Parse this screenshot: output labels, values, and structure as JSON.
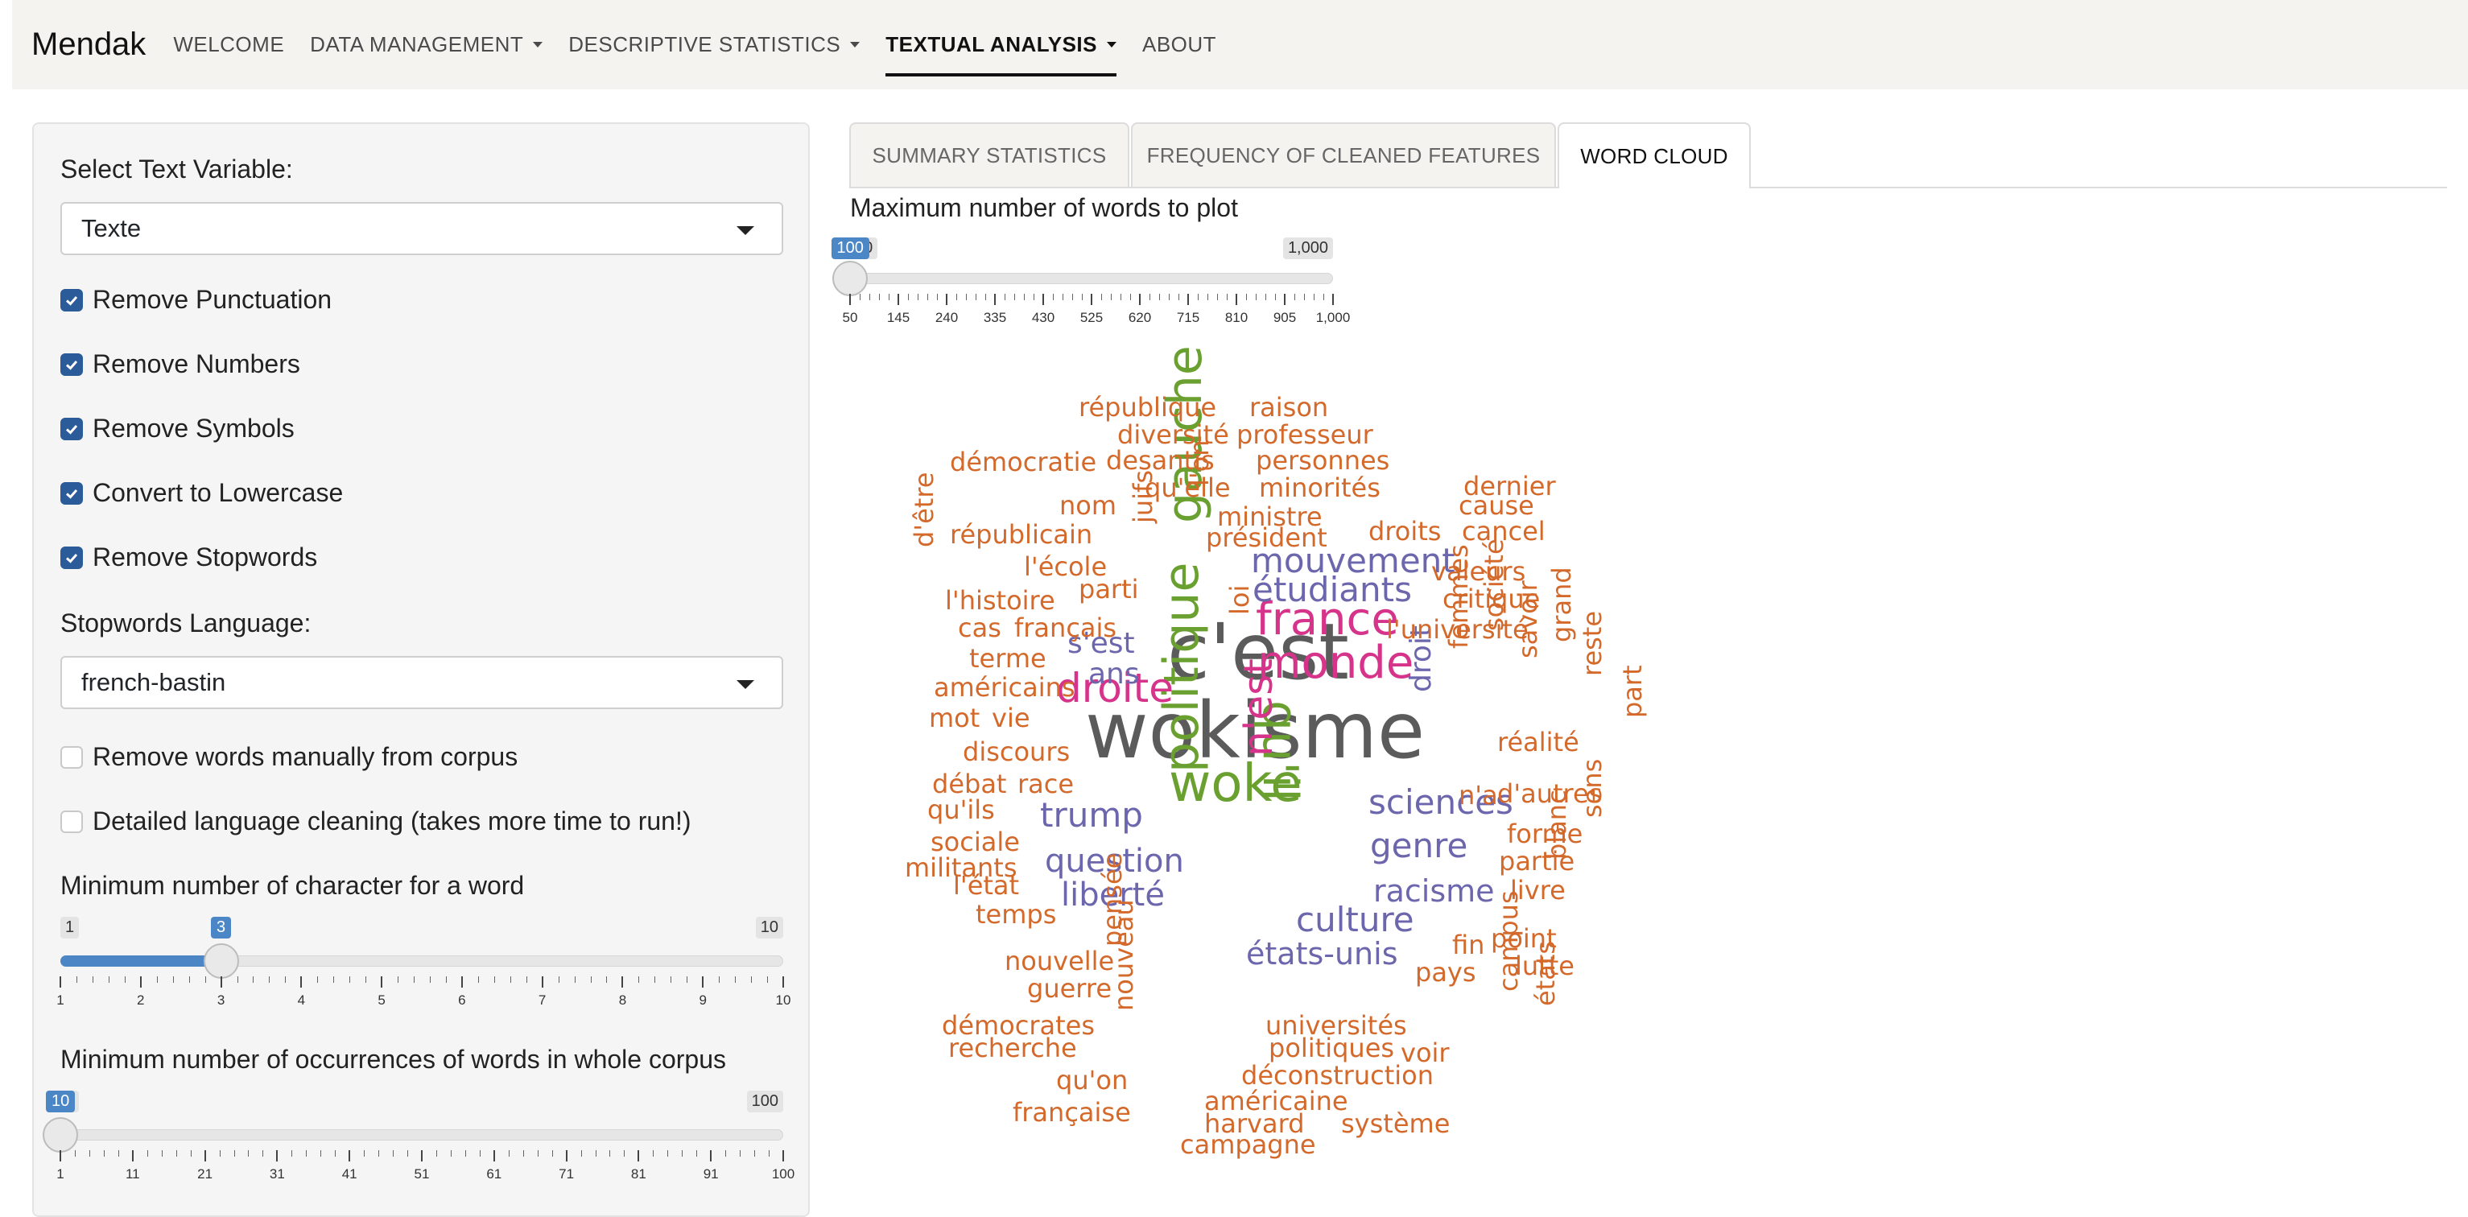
{
  "nav": {
    "brand": "Mendak",
    "items": [
      {
        "label": "WELCOME",
        "dropdown": false,
        "active": false
      },
      {
        "label": "DATA MANAGEMENT",
        "dropdown": true,
        "active": false
      },
      {
        "label": "DESCRIPTIVE STATISTICS",
        "dropdown": true,
        "active": false
      },
      {
        "label": "TEXTUAL ANALYSIS",
        "dropdown": true,
        "active": true
      },
      {
        "label": "ABOUT",
        "dropdown": false,
        "active": false
      }
    ]
  },
  "sidebar": {
    "text_variable_label": "Select Text Variable:",
    "text_variable_value": "Texte",
    "checkboxes": [
      {
        "label": "Remove Punctuation",
        "checked": true
      },
      {
        "label": "Remove Numbers",
        "checked": true
      },
      {
        "label": "Remove Symbols",
        "checked": true
      },
      {
        "label": "Convert to Lowercase",
        "checked": true
      },
      {
        "label": "Remove Stopwords",
        "checked": true
      }
    ],
    "stopwords_label": "Stopwords Language:",
    "stopwords_value": "french-bastin",
    "options": [
      {
        "label": "Remove words manually from corpus",
        "checked": false
      },
      {
        "label": "Detailed language cleaning (takes more time to run!)",
        "checked": false
      }
    ],
    "min_char": {
      "label": "Minimum number of character for a word",
      "min": "1",
      "max": "10",
      "value": "3",
      "ticks": [
        "1",
        "2",
        "3",
        "4",
        "5",
        "6",
        "7",
        "8",
        "9",
        "10"
      ]
    },
    "min_occ": {
      "label": "Minimum number of occurrences of words in whole corpus",
      "min": "1",
      "max": "100",
      "value": "10",
      "ticks": [
        "1",
        "11",
        "21",
        "31",
        "41",
        "51",
        "61",
        "71",
        "81",
        "91",
        "100"
      ]
    }
  },
  "tabs": [
    {
      "label": "SUMMARY STATISTICS",
      "active": false
    },
    {
      "label": "FREQUENCY OF CLEANED FEATURES",
      "active": false
    },
    {
      "label": "WORD CLOUD",
      "active": true
    }
  ],
  "wordcloud": {
    "max_words_label": "Maximum number of words to plot",
    "slider": {
      "min": "50",
      "max": "1,000",
      "value": "100",
      "ticks": [
        "50",
        "145",
        "240",
        "335",
        "430",
        "525",
        "620",
        "715",
        "810",
        "905",
        "1,000"
      ]
    },
    "colors": {
      "gray": "#5b5b5b",
      "green": "#6aa02f",
      "pink": "#d6338a",
      "purple": "#6c66ad",
      "orange": "#d3692a"
    },
    "words": [
      {
        "text": "wokisme",
        "color": "gray",
        "tier": 1
      },
      {
        "text": "c'est",
        "color": "gray",
        "tier": 1
      },
      {
        "text": "woke",
        "color": "green",
        "tier": 2
      },
      {
        "text": "gauche",
        "color": "green",
        "tier": 2
      },
      {
        "text": "politique",
        "color": "green",
        "tier": 2
      },
      {
        "text": "qu'il",
        "color": "green",
        "tier": 2
      },
      {
        "text": "france",
        "color": "pink",
        "tier": 3
      },
      {
        "text": "monde",
        "color": "pink",
        "tier": 3
      },
      {
        "text": "droite",
        "color": "pink",
        "tier": 3
      },
      {
        "text": "n'est",
        "color": "pink",
        "tier": 3
      },
      {
        "text": "mouvement",
        "color": "purple",
        "tier": 4
      },
      {
        "text": "étudiants",
        "color": "purple",
        "tier": 4
      },
      {
        "text": "sciences",
        "color": "purple",
        "tier": 4
      },
      {
        "text": "genre",
        "color": "purple",
        "tier": 4
      },
      {
        "text": "trump",
        "color": "purple",
        "tier": 4
      },
      {
        "text": "culture",
        "color": "purple",
        "tier": 4
      },
      {
        "text": "question",
        "color": "purple",
        "tier": 4
      },
      {
        "text": "liberté",
        "color": "purple",
        "tier": 4
      },
      {
        "text": "racisme",
        "color": "purple",
        "tier": 4
      },
      {
        "text": "s'est",
        "color": "purple",
        "tier": 4
      },
      {
        "text": "ans",
        "color": "purple",
        "tier": 4
      },
      {
        "text": "droit",
        "color": "purple",
        "tier": 4
      },
      {
        "text": "états-unis",
        "color": "purple",
        "tier": 4
      },
      {
        "text": "république",
        "color": "orange",
        "tier": 5
      },
      {
        "text": "raison",
        "color": "orange",
        "tier": 5
      },
      {
        "text": "diversité",
        "color": "orange",
        "tier": 5
      },
      {
        "text": "professeur",
        "color": "orange",
        "tier": 5
      },
      {
        "text": "démocratie",
        "color": "orange",
        "tier": 5
      },
      {
        "text": "desantis",
        "color": "orange",
        "tier": 5
      },
      {
        "text": "personnes",
        "color": "orange",
        "tier": 5
      },
      {
        "text": "qu'elle",
        "color": "orange",
        "tier": 5
      },
      {
        "text": "minorités",
        "color": "orange",
        "tier": 5
      },
      {
        "text": "dernier",
        "color": "orange",
        "tier": 5
      },
      {
        "text": "nom",
        "color": "orange",
        "tier": 5
      },
      {
        "text": "ministre",
        "color": "orange",
        "tier": 5
      },
      {
        "text": "cause",
        "color": "orange",
        "tier": 5
      },
      {
        "text": "républicain",
        "color": "orange",
        "tier": 5
      },
      {
        "text": "président",
        "color": "orange",
        "tier": 5
      },
      {
        "text": "droits",
        "color": "orange",
        "tier": 5
      },
      {
        "text": "cancel",
        "color": "orange",
        "tier": 5
      },
      {
        "text": "l'école",
        "color": "orange",
        "tier": 5
      },
      {
        "text": "juifs",
        "color": "orange",
        "tier": 5
      },
      {
        "text": "l'on",
        "color": "orange",
        "tier": 5
      },
      {
        "text": "valeurs",
        "color": "orange",
        "tier": 5
      },
      {
        "text": "parti",
        "color": "orange",
        "tier": 5
      },
      {
        "text": "critique",
        "color": "orange",
        "tier": 5
      },
      {
        "text": "l'histoire",
        "color": "orange",
        "tier": 5
      },
      {
        "text": "d'être",
        "color": "orange",
        "tier": 5
      },
      {
        "text": "cas",
        "color": "orange",
        "tier": 5
      },
      {
        "text": "français",
        "color": "orange",
        "tier": 5
      },
      {
        "text": "loi",
        "color": "orange",
        "tier": 5
      },
      {
        "text": "l'université",
        "color": "orange",
        "tier": 5
      },
      {
        "text": "terme",
        "color": "orange",
        "tier": 5
      },
      {
        "text": "société",
        "color": "orange",
        "tier": 5
      },
      {
        "text": "femmes",
        "color": "orange",
        "tier": 5
      },
      {
        "text": "savoir",
        "color": "orange",
        "tier": 5
      },
      {
        "text": "grand",
        "color": "orange",
        "tier": 5
      },
      {
        "text": "américains",
        "color": "orange",
        "tier": 5
      },
      {
        "text": "reste",
        "color": "orange",
        "tier": 5
      },
      {
        "text": "mot",
        "color": "orange",
        "tier": 5
      },
      {
        "text": "vie",
        "color": "orange",
        "tier": 5
      },
      {
        "text": "part",
        "color": "orange",
        "tier": 5
      },
      {
        "text": "réalité",
        "color": "orange",
        "tier": 5
      },
      {
        "text": "discours",
        "color": "orange",
        "tier": 5
      },
      {
        "text": "débat",
        "color": "orange",
        "tier": 5
      },
      {
        "text": "race",
        "color": "orange",
        "tier": 5
      },
      {
        "text": "n'a",
        "color": "orange",
        "tier": 5
      },
      {
        "text": "d'autres",
        "color": "orange",
        "tier": 5
      },
      {
        "text": "qu'ils",
        "color": "orange",
        "tier": 5
      },
      {
        "text": "forme",
        "color": "orange",
        "tier": 5
      },
      {
        "text": "sociale",
        "color": "orange",
        "tier": 5
      },
      {
        "text": "partie",
        "color": "orange",
        "tier": 5
      },
      {
        "text": "militants",
        "color": "orange",
        "tier": 5
      },
      {
        "text": "sens",
        "color": "orange",
        "tier": 5
      },
      {
        "text": "l'état",
        "color": "orange",
        "tier": 5
      },
      {
        "text": "livre",
        "color": "orange",
        "tier": 5
      },
      {
        "text": "blanc",
        "color": "orange",
        "tier": 5
      },
      {
        "text": "temps",
        "color": "orange",
        "tier": 5
      },
      {
        "text": "fin",
        "color": "orange",
        "tier": 5
      },
      {
        "text": "point",
        "color": "orange",
        "tier": 5
      },
      {
        "text": "nouvelle",
        "color": "orange",
        "tier": 5
      },
      {
        "text": "pensée",
        "color": "orange",
        "tier": 5
      },
      {
        "text": "guerre",
        "color": "orange",
        "tier": 5
      },
      {
        "text": "pays",
        "color": "orange",
        "tier": 5
      },
      {
        "text": "lutte",
        "color": "orange",
        "tier": 5
      },
      {
        "text": "campus",
        "color": "orange",
        "tier": 5
      },
      {
        "text": "états",
        "color": "orange",
        "tier": 5
      },
      {
        "text": "nouveau",
        "color": "orange",
        "tier": 5
      },
      {
        "text": "démocrates",
        "color": "orange",
        "tier": 5
      },
      {
        "text": "universités",
        "color": "orange",
        "tier": 5
      },
      {
        "text": "recherche",
        "color": "orange",
        "tier": 5
      },
      {
        "text": "politiques",
        "color": "orange",
        "tier": 5
      },
      {
        "text": "voir",
        "color": "orange",
        "tier": 5
      },
      {
        "text": "qu'on",
        "color": "orange",
        "tier": 5
      },
      {
        "text": "déconstruction",
        "color": "orange",
        "tier": 5
      },
      {
        "text": "américaine",
        "color": "orange",
        "tier": 5
      },
      {
        "text": "française",
        "color": "orange",
        "tier": 5
      },
      {
        "text": "harvard",
        "color": "orange",
        "tier": 5
      },
      {
        "text": "système",
        "color": "orange",
        "tier": 5
      },
      {
        "text": "campagne",
        "color": "orange",
        "tier": 5
      }
    ]
  }
}
